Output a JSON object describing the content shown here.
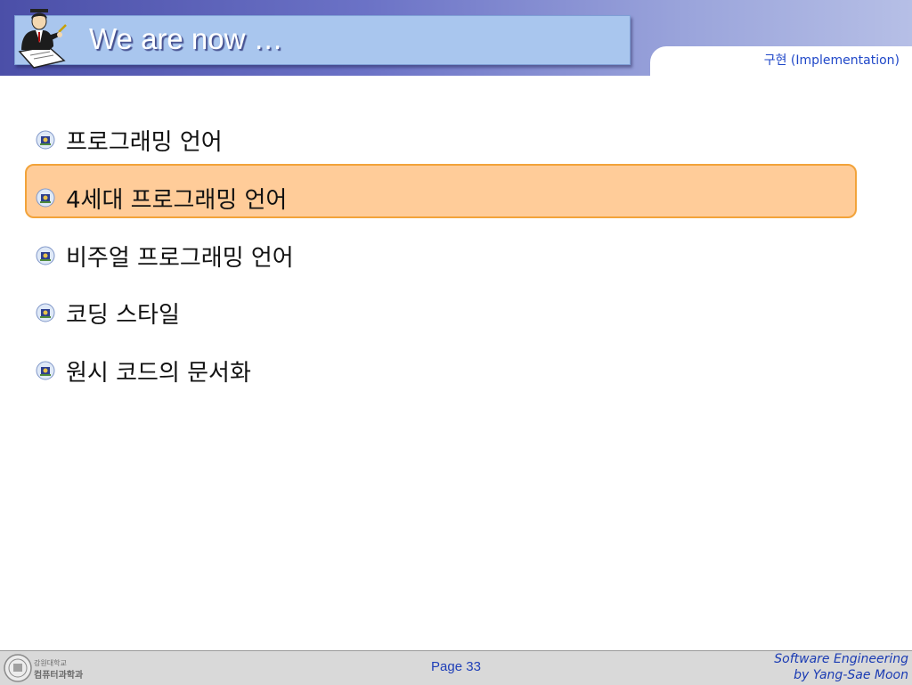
{
  "header": {
    "title": "We are now …",
    "section_label": "구현 (Implementation)"
  },
  "list": {
    "items": [
      {
        "label": "프로그래밍 언어"
      },
      {
        "label": "4세대 프로그래밍 언어",
        "highlighted": true
      },
      {
        "label": "비주얼 프로그래밍 언어"
      },
      {
        "label": "코딩 스타일"
      },
      {
        "label": "원시 코드의 문서화"
      }
    ]
  },
  "footer": {
    "logo_text_line1": "강원대학교",
    "logo_text_line2": "컴퓨터과학과",
    "page": "Page 33",
    "credit_line1": "Software Engineering",
    "credit_line2": "by Yang-Sae Moon"
  },
  "colors": {
    "header_gradient_start": "#4b4fa8",
    "title_box": "#a9c6ee",
    "highlight_fill": "#ffcc99",
    "highlight_border": "#f2a33a",
    "accent_text": "#1f3fb8"
  },
  "icons": {
    "presenter": "presenter-figure-icon",
    "bullet": "university-emblem-bullet-icon",
    "footer_logo": "university-seal-icon"
  }
}
